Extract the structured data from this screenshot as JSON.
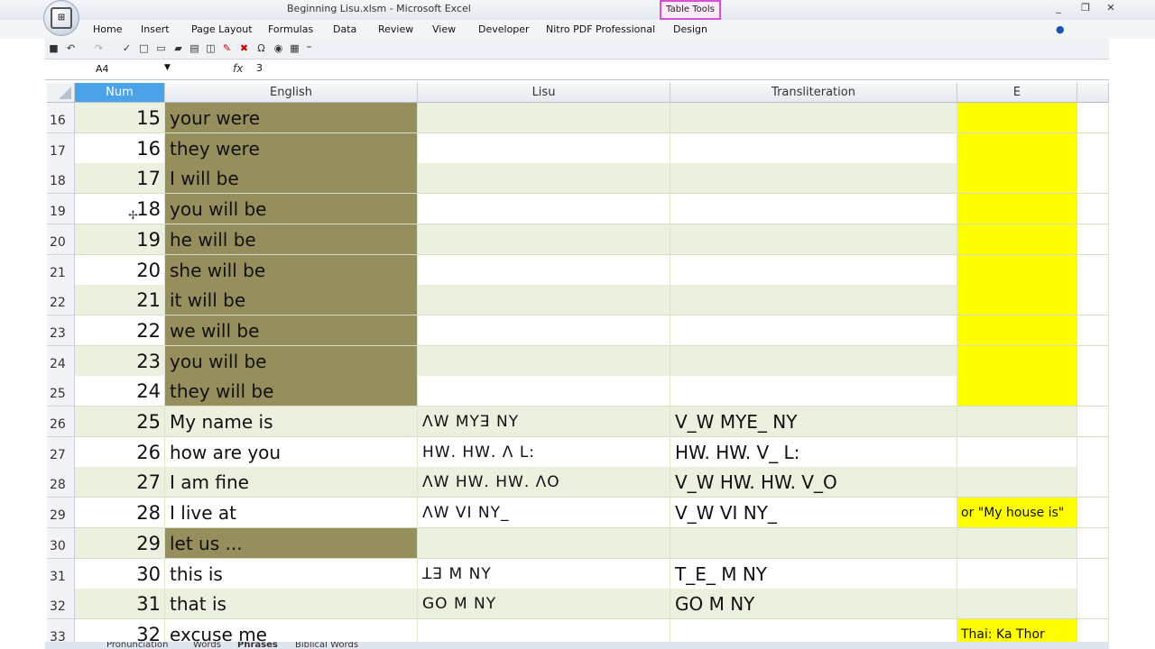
{
  "window": {
    "title": "Beginning Lisu.xlsm - Microsoft Excel",
    "context_tab": "Table Tools",
    "controls": [
      "_",
      "❐",
      "✕"
    ]
  },
  "ribbon": {
    "tabs": [
      "Home",
      "Insert",
      "Page Layout",
      "Formulas",
      "Data",
      "Review",
      "View",
      "Developer",
      "Nitro PDF Professional",
      "Design"
    ]
  },
  "formula_bar": {
    "name_box": "A4",
    "fx_label": "fx",
    "value": "3"
  },
  "columns": [
    "Num",
    "English",
    "Lisu",
    "Transliteration",
    "E"
  ],
  "rows": [
    {
      "rownum": "16",
      "num": "15",
      "english": "your were",
      "lisu": "",
      "translit": "",
      "e": ""
    },
    {
      "rownum": "17",
      "num": "16",
      "english": "they were",
      "lisu": "",
      "translit": "",
      "e": ""
    },
    {
      "rownum": "18",
      "num": "17",
      "english": "I will be",
      "lisu": "",
      "translit": "",
      "e": ""
    },
    {
      "rownum": "19",
      "num": "18",
      "english": "you will be",
      "lisu": "",
      "translit": "",
      "e": ""
    },
    {
      "rownum": "20",
      "num": "19",
      "english": "he will be",
      "lisu": "",
      "translit": "",
      "e": ""
    },
    {
      "rownum": "21",
      "num": "20",
      "english": "she will be",
      "lisu": "",
      "translit": "",
      "e": ""
    },
    {
      "rownum": "22",
      "num": "21",
      "english": "it will be",
      "lisu": "",
      "translit": "",
      "e": ""
    },
    {
      "rownum": "23",
      "num": "22",
      "english": "we will be",
      "lisu": "",
      "translit": "",
      "e": ""
    },
    {
      "rownum": "24",
      "num": "23",
      "english": "you will be",
      "lisu": "",
      "translit": "",
      "e": ""
    },
    {
      "rownum": "25",
      "num": "24",
      "english": "they will be",
      "lisu": "",
      "translit": "",
      "e": ""
    },
    {
      "rownum": "26",
      "num": "25",
      "english": "My name is",
      "lisu": "ꓥꓪ ꓟꓬꓱ ꓠꓬ",
      "translit": "V_W MYE_ NY",
      "e": ""
    },
    {
      "rownum": "27",
      "num": "26",
      "english": "how are you",
      "lisu": "ꓧꓪ. ꓧꓪ. ꓥ ꓡ:",
      "translit": "HW. HW. V_ L:",
      "e": ""
    },
    {
      "rownum": "28",
      "num": "27",
      "english": "I am fine",
      "lisu": "ꓥꓪ ꓧꓪ. ꓧꓪ. ꓥꓳ",
      "translit": "V_W HW. HW. V_O",
      "e": ""
    },
    {
      "rownum": "29",
      "num": "28",
      "english": "I live at",
      "lisu": "ꓥꓪ ꓦꓲ ꓠꓬ_",
      "translit": "V_W VI NY_",
      "e": "or \"My house is\""
    },
    {
      "rownum": "30",
      "num": "29",
      "english": "let us ...",
      "lisu": "",
      "translit": "",
      "e": ""
    },
    {
      "rownum": "31",
      "num": "30",
      "english": "this is",
      "lisu": "ꓕꓱ ꓟ ꓠꓬ",
      "translit": "T_E_ M NY",
      "e": ""
    },
    {
      "rownum": "32",
      "num": "31",
      "english": "that is",
      "lisu": "ꓖꓳ ꓟ ꓠꓬ",
      "translit": "GO M NY",
      "e": ""
    },
    {
      "rownum": "33",
      "num": "32",
      "english": "excuse me",
      "lisu": "",
      "translit": "",
      "e": "Thai: Ka Thor"
    }
  ],
  "sheet_tabs": [
    "Pronunciation",
    "Words",
    "Phrases",
    "Biblical Words"
  ],
  "colors": {
    "olive": "#978e5d",
    "band_green": "#ebf1de",
    "yellow": "#ffff00",
    "header_selected": "#4aa3e8"
  }
}
